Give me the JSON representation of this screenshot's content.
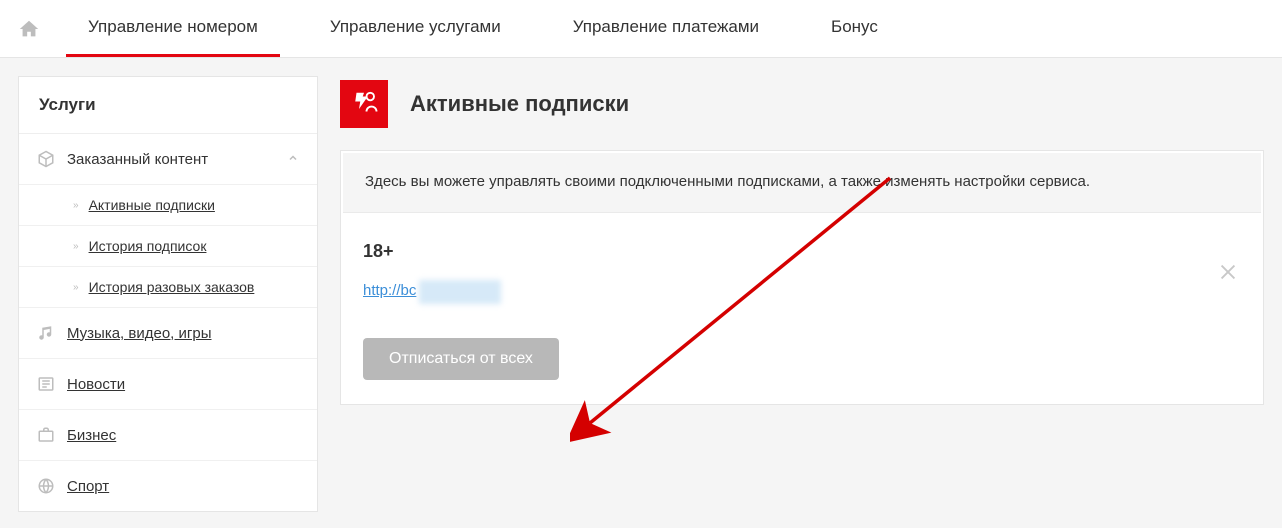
{
  "nav": {
    "tabs": [
      {
        "label": "Управление номером",
        "active": true
      },
      {
        "label": "Управление услугами",
        "active": false
      },
      {
        "label": "Управление платежами",
        "active": false
      },
      {
        "label": "Бонус",
        "active": false
      }
    ]
  },
  "sidebar": {
    "title": "Услуги",
    "group": {
      "label": "Заказанный контент",
      "expanded": true,
      "items": [
        {
          "label": "Активные подписки"
        },
        {
          "label": "История подписок"
        },
        {
          "label": "История разовых заказов"
        }
      ]
    },
    "categories": [
      {
        "icon": "music",
        "label": "Музыка, видео, игры"
      },
      {
        "icon": "news",
        "label": "Новости"
      },
      {
        "icon": "business",
        "label": "Бизнес"
      },
      {
        "icon": "sport",
        "label": "Спорт"
      }
    ]
  },
  "main": {
    "title": "Активные подписки",
    "info": "Здесь вы можете управлять своими подключенными подписками, а также изменять настройки сервиса.",
    "subscription": {
      "name": "18+",
      "url": "http://bc"
    },
    "unsubscribe_all": "Отписаться от всех"
  }
}
